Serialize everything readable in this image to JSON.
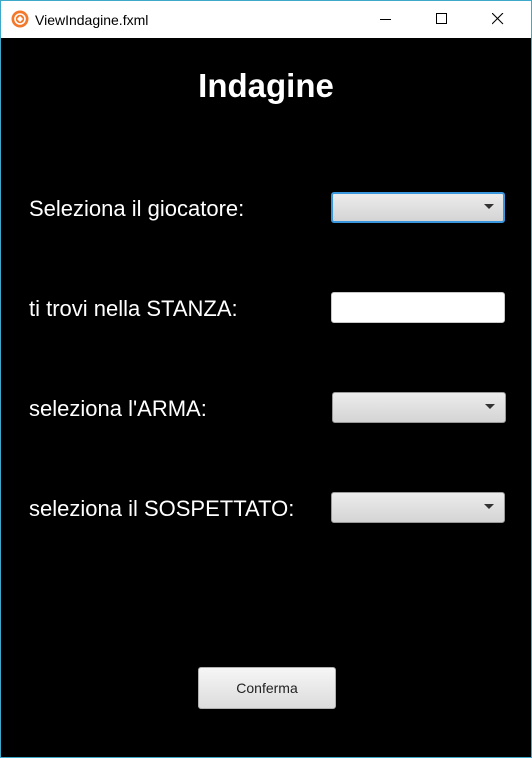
{
  "window": {
    "title": "ViewIndagine.fxml",
    "controls": [
      "minimize-icon",
      "maximize-icon",
      "close-icon"
    ]
  },
  "main": {
    "heading": "Indagine",
    "fields": [
      {
        "label": "Seleziona il giocatore:",
        "control": "combobox",
        "value": "",
        "focused": true
      },
      {
        "label": "ti trovi nella STANZA:",
        "control": "textfield",
        "value": ""
      },
      {
        "label": "seleziona l'ARMA:",
        "control": "combobox",
        "value": ""
      },
      {
        "label": "seleziona il SOSPETTATO:",
        "control": "combobox",
        "value": ""
      }
    ],
    "confirm_label": "Conferma"
  },
  "colors": {
    "background": "#000000",
    "text": "#ffffff",
    "focus": "#3a96dd",
    "window_border": "#3fa9c9",
    "app_icon": "#f4782a"
  }
}
